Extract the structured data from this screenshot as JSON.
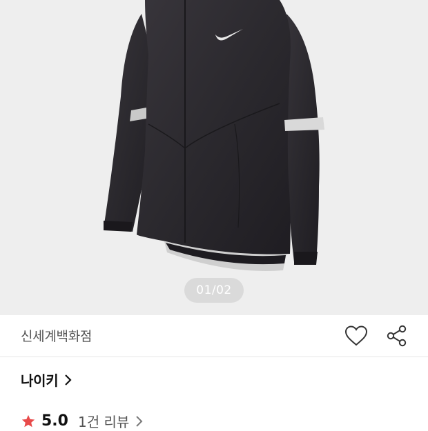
{
  "gallery": {
    "pager_text": "01/02"
  },
  "store": {
    "name": "신세계백화점"
  },
  "brand": {
    "name": "나이키"
  },
  "rating": {
    "value": "5.0",
    "reviews_label": "1건 리뷰"
  },
  "colors": {
    "hero_bg": "#eeeeee",
    "star": "#e84a4a",
    "jacket": "#2a282d"
  },
  "icons": {
    "heart": "heart-outline-icon",
    "share": "share-icon",
    "brand_chevron": "chevron-right-icon",
    "review_chevron": "chevron-right-icon",
    "star": "star-icon"
  }
}
